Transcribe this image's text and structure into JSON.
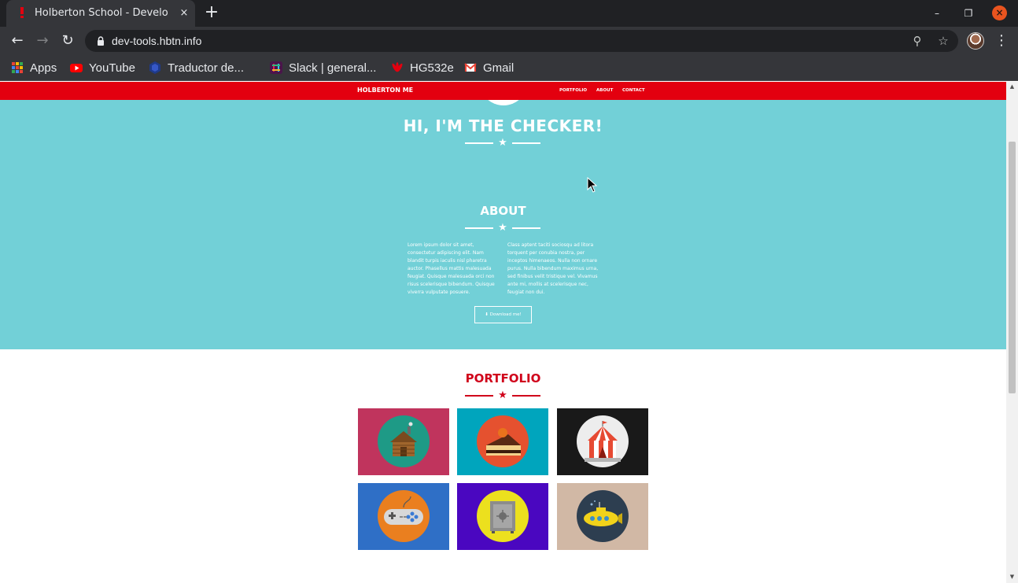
{
  "browser": {
    "tab_title": "Holberton School - Develo",
    "url": "dev-tools.hbtn.info",
    "tab_close": "×",
    "new_tab": "+",
    "window_minimize": "–",
    "window_restore": "❐",
    "window_close": "×"
  },
  "bookmarks": [
    {
      "label": "Apps",
      "icon": "apps-grid-icon"
    },
    {
      "label": "YouTube",
      "icon": "youtube-icon"
    },
    {
      "label": "Traductor de...",
      "icon": "translator-icon"
    },
    {
      "label": "Slack | general...",
      "icon": "slack-icon"
    },
    {
      "label": "HG532e",
      "icon": "huawei-icon"
    },
    {
      "label": "Gmail",
      "icon": "gmail-icon"
    }
  ],
  "site": {
    "brand": "HOLBERTON ME",
    "nav": [
      "PORTFOLIO",
      "ABOUT",
      "CONTACT"
    ],
    "hero_title": "HI, I'M THE CHECKER!",
    "about_title": "ABOUT",
    "about_left": "Lorem ipsum dolor sit amet, consectetur adipiscing elit. Nam blandit turpis iaculis nisl pharetra auctor. Phasellus mattis malesuada feugiat. Quisque malesuada orci non risus scelerisque bibendum. Quisque viverra vulputate posuere.",
    "about_right": "Class aptent taciti sociosqu ad litora torquent per conubia nostra, per inceptos himenaeos. Nulla non ornare purus. Nulla bibendum maximus urna, sed finibus velit tristique vel. Vivamus ante mi, mollis at scelerisque nec, feugiat non dui.",
    "download_label": "Download me!",
    "portfolio_title": "PORTFOLIO",
    "portfolio": [
      {
        "name": "cabin",
        "bg": "#c0345d",
        "circle": "#1e9a86"
      },
      {
        "name": "cake",
        "bg": "#00a5bd",
        "circle": "#e5512f"
      },
      {
        "name": "circus",
        "bg": "#191919",
        "circle": "#ededed"
      },
      {
        "name": "game-controller",
        "bg": "#2f6fc6",
        "circle": "#ea7f1f"
      },
      {
        "name": "safe",
        "bg": "#4a07c0",
        "circle": "#ece01e"
      },
      {
        "name": "submarine",
        "bg": "#d1b8a5",
        "circle": "#2d3e50"
      }
    ]
  },
  "colors": {
    "nav_red": "#e3000f",
    "hero_teal": "#72d0d7",
    "portfolio_red": "#d0021b"
  }
}
